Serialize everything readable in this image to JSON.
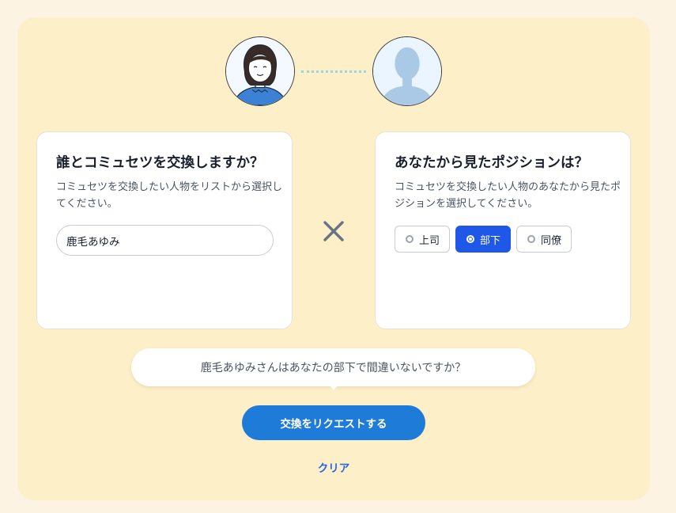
{
  "partner_card": {
    "title": "誰とコミュセツを交換しますか？",
    "description": "コミュセツを交換したい人物をリストから選択してください。",
    "selected_name": "鹿毛あゆみ"
  },
  "position_card": {
    "title": "あなたから見たポジションは？",
    "description": "コミュセツを交換したい人物のあなたから見たポジションを選択してください。",
    "options": [
      {
        "label": "上司",
        "selected": false
      },
      {
        "label": "部下",
        "selected": true
      },
      {
        "label": "同僚",
        "selected": false
      }
    ]
  },
  "confirmation": "鹿毛あゆみさんはあなたの部下で間違いないですか？",
  "request_button": "交換をリクエストする",
  "clear_link": "クリア",
  "icons": {
    "self_avatar": "person-illustration-icon",
    "partner_avatar": "person-silhouette-icon",
    "combine": "times-icon"
  },
  "colors": {
    "page_bg": "#fdf3e3",
    "panel_bg": "#fdefc8",
    "primary": "#1e7bd8",
    "selected": "#1f57e8",
    "link": "#2563eb"
  }
}
